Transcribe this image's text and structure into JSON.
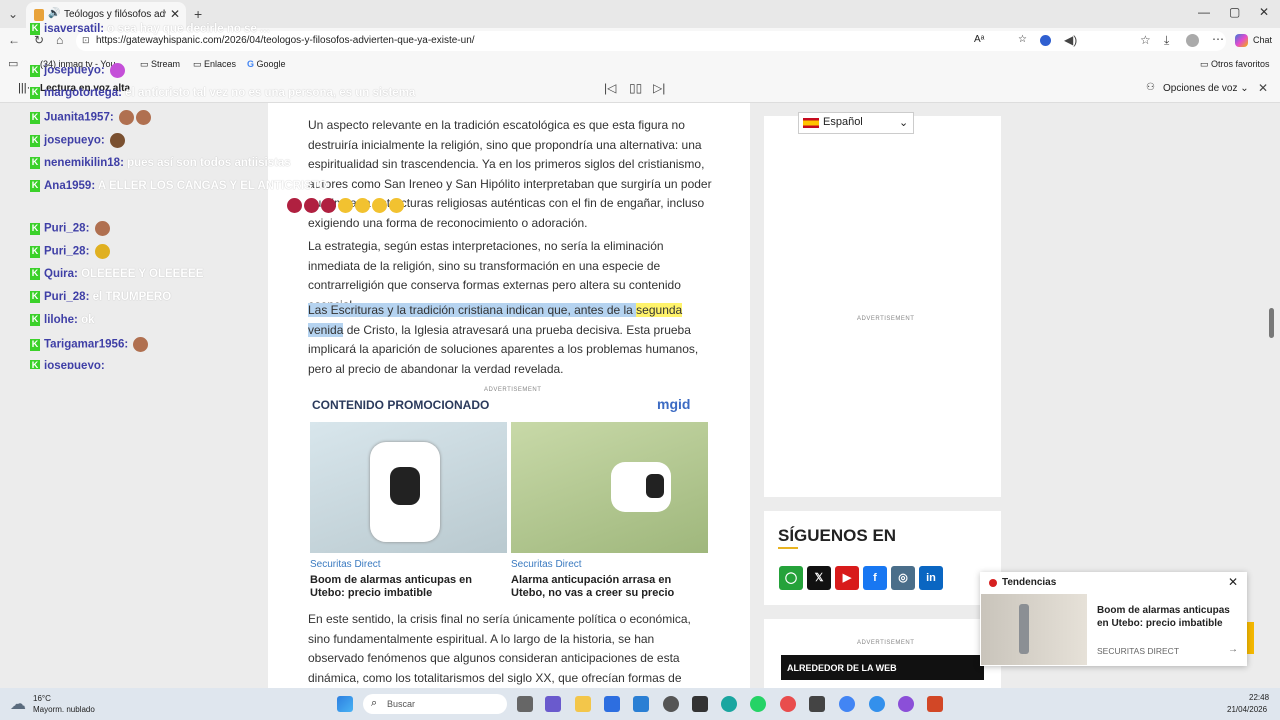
{
  "browser": {
    "tab_title": "Teólogos y filósofos advierten",
    "url": "https://gatewayhispanic.com/2026/04/teologos-y-filosofos-advierten-que-ya-existe-un/",
    "chat_label": "Chat",
    "bookmarks": [
      "(34) inmaq tv - You...",
      "Stream",
      "Enlaces",
      "Google"
    ],
    "other_favorites": "Otros favoritos"
  },
  "read_aloud": {
    "label": "Lectura en voz alta",
    "voice_options": "Opciones de voz"
  },
  "article": {
    "p1": "Un aspecto relevante en la tradición escatológica es que esta figura no destruiría inicialmente la religión, sino que propondría una alternativa: una espiritualidad sin trascendencia. Ya en los primeros siglos del cristianismo, autores como San Ireneo y San Hipólito interpretaban que surgiría un poder que imitaría estructuras religiosas auténticas con el fin de engañar, incluso exigiendo una forma de reconocimiento o adoración.",
    "p2": "La estrategia, según estas interpretaciones, no sería la eliminación inmediata de la religión, sino su transformación en una especie de contrarreligión que conserva formas externas pero altera su contenido esencial.",
    "p3_highlight_a": "Las Escrituras y la tradición cristiana indican que, antes de la ",
    "p3_highlight_word": "segunda",
    "p3_highlight_b": " venida",
    "p3_rest": " de Cristo, la Iglesia atravesará una prueba decisiva. Esta prueba implicará la aparición de soluciones aparentes a los problemas humanos, pero al precio de abandonar la verdad revelada.",
    "p4": "En este sentido, la crisis final no sería únicamente política o económica, sino fundamentalmente espiritual. A lo largo de la historia, se han observado fenómenos que algunos consideran anticipaciones de esta dinámica, como los totalitarismos del siglo XX, que ofrecían formas de “salvación” terrenal"
  },
  "promo": {
    "ad_label": "ADVERTISEMENT",
    "heading": "CONTENIDO PROMOCIONADO",
    "brand": "mgid",
    "cards": [
      {
        "source": "Securitas Direct",
        "title": "Boom de alarmas anticupas en Utebo: precio imbatible"
      },
      {
        "source": "Securitas Direct",
        "title": "Alarma anticupación arrasa en Utebo, no vas a creer su precio"
      }
    ]
  },
  "sidebar": {
    "language": "Español",
    "ad_label": "ADVERTISEMENT",
    "follow_title": "SÍGUENOS EN",
    "web_title": "ALREDEDOR DE LA WEB"
  },
  "toast": {
    "header": "Tendencias",
    "title": "Boom de alarmas anticupas en Utebo: precio imbatible",
    "source": "SECURITAS DIRECT"
  },
  "chat": [
    {
      "user": "isaversatil",
      "msg": "o sea hay que decirle no se ..."
    },
    {
      "user": "josepueyo",
      "msg": ""
    },
    {
      "user": "margotortega",
      "msg": "el anticristo tal vez no es una persona, es un sistema"
    },
    {
      "user": "Juanita1957",
      "msg": ""
    },
    {
      "user": "josepueyo",
      "msg": ""
    },
    {
      "user": "nenemikilin18",
      "msg": "pues así son todos antiisistas"
    },
    {
      "user": "Ana1959",
      "msg": "A ELLER LOS CANGAS Y EL ANTICRISTO"
    },
    {
      "user": "Puri_28",
      "msg": ""
    },
    {
      "user": "Puri_28",
      "msg": ""
    },
    {
      "user": "Quira",
      "msg": "OLEEEEE Y OLEEEEE"
    },
    {
      "user": "Puri_28",
      "msg": "el TRUMPERO"
    },
    {
      "user": "lilohe",
      "msg": "ok"
    },
    {
      "user": "Tarigamar1956",
      "msg": ""
    },
    {
      "user": "josepueyo",
      "msg": ""
    }
  ],
  "taskbar": {
    "weather_temp": "16°C",
    "weather_desc": "Mayorm. nublado",
    "search_placeholder": "Buscar",
    "time": "22:48",
    "date": "21/04/2026"
  }
}
